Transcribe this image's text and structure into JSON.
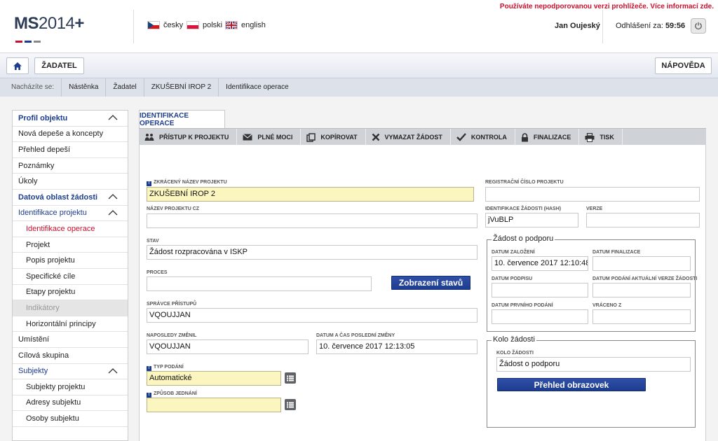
{
  "header": {
    "warning": "Používáte nepodporovanou verzi prohlížeče. Více informací zde.",
    "logo": {
      "ms": "MS",
      "year": "2014",
      "plus": "+"
    },
    "languages": [
      {
        "label": "česky",
        "flag": "cz-flag"
      },
      {
        "label": "polski",
        "flag": "pl-flag"
      },
      {
        "label": "english",
        "flag": "uk-flag"
      }
    ],
    "user": "Jan Oujeský",
    "logout_label": "Odhlášení za:",
    "logout_time": "59:56"
  },
  "toolbar": {
    "home_icon": "home-icon",
    "zadatel": "ŽADATEL",
    "napoveda": "NÁPOVĚDA"
  },
  "breadcrumb": {
    "lead": "Nacházíte se:",
    "items": [
      "Nástěnka",
      "Žadatel",
      "ZKUŠEBNÍ IROP 2",
      "Identifikace operace"
    ]
  },
  "sidebar": {
    "items": [
      {
        "label": "Profil objektu",
        "kind": "section"
      },
      {
        "label": "Nová depeše a koncepty"
      },
      {
        "label": "Přehled depeší"
      },
      {
        "label": "Poznámky"
      },
      {
        "label": "Úkoly"
      },
      {
        "label": "Datová oblast žádosti",
        "kind": "section"
      },
      {
        "label": "Identifikace projektu",
        "kind": "sub"
      },
      {
        "label": "Identifikace operace",
        "kind": "active"
      },
      {
        "label": "Projekt",
        "kind": "child"
      },
      {
        "label": "Popis projektu",
        "kind": "child"
      },
      {
        "label": "Specifické cíle",
        "kind": "child"
      },
      {
        "label": "Etapy projektu",
        "kind": "child"
      },
      {
        "label": "Indikátory",
        "kind": "disabled"
      },
      {
        "label": "Horizontální principy",
        "kind": "child"
      },
      {
        "label": "Umístění"
      },
      {
        "label": "Cílová skupina"
      },
      {
        "label": "Subjekty",
        "kind": "sub"
      },
      {
        "label": "Subjekty projektu",
        "kind": "child"
      },
      {
        "label": "Adresy subjektu",
        "kind": "child"
      },
      {
        "label": "Osoby subjektu",
        "kind": "child"
      }
    ]
  },
  "main": {
    "tab": "IDENTIFIKACE OPERACE",
    "actions": [
      {
        "label": "PŘÍSTUP K PROJEKTU",
        "icon": "people-icon"
      },
      {
        "label": "PLNÉ MOCI",
        "icon": "envelope-icon"
      },
      {
        "label": "KOPÍROVAT",
        "icon": "copy-icon"
      },
      {
        "label": "VYMAZAT ŽÁDOST",
        "icon": "delete-icon"
      },
      {
        "label": "KONTROLA",
        "icon": "check-icon"
      },
      {
        "label": "FINALIZACE",
        "icon": "lock-icon"
      },
      {
        "label": "TISK",
        "icon": "print-icon"
      }
    ],
    "form": {
      "zkraceny_nazev_label": "ZKRÁCENÝ NÁZEV PROJEKTU",
      "zkraceny_nazev_value": "ZKUŠEBNÍ IROP 2",
      "nazev_cz_label": "NÁZEV PROJEKTU CZ",
      "nazev_cz_value": "",
      "stav_label": "STAV",
      "stav_value": "Žádost rozpracována v ISKP",
      "proces_label": "PROCES",
      "proces_value": "",
      "zobrazeni_stavu": "Zobrazení stavů",
      "spravce_label": "SPRÁVCE PŘÍSTUPŮ",
      "spravce_value": "VQOUJJAN",
      "naposledy_label": "NAPOSLEDY ZMĚNIL",
      "naposledy_value": "VQOUJJAN",
      "datum_zmeny_label": "DATUM A ČAS POSLEDNÍ ZMĚNY",
      "datum_zmeny_value": "10. července 2017 12:13:05",
      "typ_podani_label": "TYP PODÁNÍ",
      "typ_podani_value": "Automatické",
      "zpusob_label": "ZPŮSOB JEDNÁNÍ",
      "zpusob_value": "",
      "reg_cislo_label": "REGISTRAČNÍ ČÍSLO PROJEKTU",
      "reg_cislo_value": "",
      "hash_label": "IDENTIFIKACE ŽÁDOSTI (HASH)",
      "hash_value": "jVuBLP",
      "verze_label": "VERZE",
      "verze_value": "",
      "zadost_legend": "Žádost o podporu",
      "datum_zalozeni_label": "DATUM ZALOŽENÍ",
      "datum_zalozeni_value": "10. července 2017 12:10:48",
      "datum_finalizace_label": "DATUM FINALIZACE",
      "datum_finalizace_value": "",
      "datum_podpisu_label": "DATUM PODPISU",
      "datum_podpisu_value": "",
      "datum_podani_label": "DATUM PODÁNÍ AKTUÁLNÍ VERZE ŽÁDOSTI",
      "datum_podani_value": "",
      "datum_prvniho_label": "DATUM PRVNÍHO PODÁNÍ",
      "datum_prvniho_value": "",
      "vraceno_label": "VRÁCENO Z",
      "vraceno_value": "",
      "kolo_legend": "Kolo žádosti",
      "kolo_label": "KOLO ŽÁDOSTI",
      "kolo_value": "Žádost o podporu",
      "prehled_obrazovek": "Přehled obrazovek"
    }
  },
  "colors": {
    "accent": "#1c3d8f",
    "warning": "#c8102e",
    "required_bg": "#fbf5c0"
  }
}
